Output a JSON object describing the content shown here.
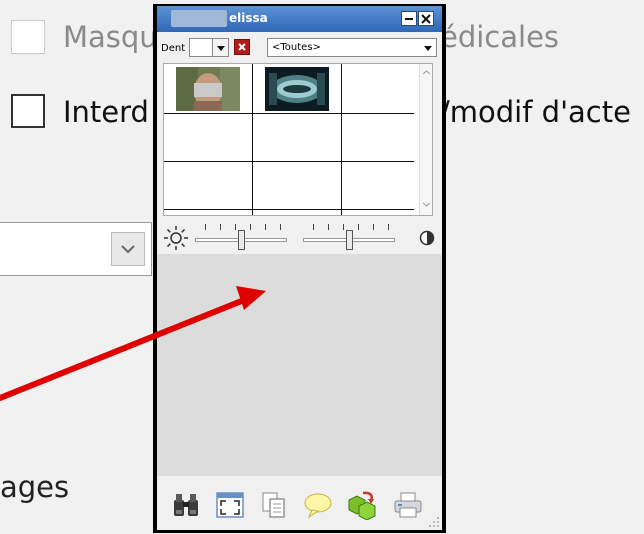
{
  "background": {
    "checkbox1_label_left": "Masqu",
    "checkbox1_label_right": "édicales",
    "checkbox2_label_left": "Interd",
    "checkbox2_label_right": "/modif d'acte",
    "bottom_text": "ages"
  },
  "panel": {
    "title": "elissa",
    "dent_label": "Dent",
    "dent_value": "",
    "category_selected": "<Toutes>",
    "brightness_level": 0.5,
    "contrast_level": 0.5
  },
  "icons": [
    "binoculars-icon",
    "fullscreen-icon",
    "copy-icon",
    "comment-icon",
    "export-icon",
    "print-icon",
    "sun-icon",
    "contrast-icon"
  ],
  "colors": {
    "titlebar": "#3a74c4",
    "arrow": "#e00000",
    "clear_button": "#b11b1b"
  }
}
